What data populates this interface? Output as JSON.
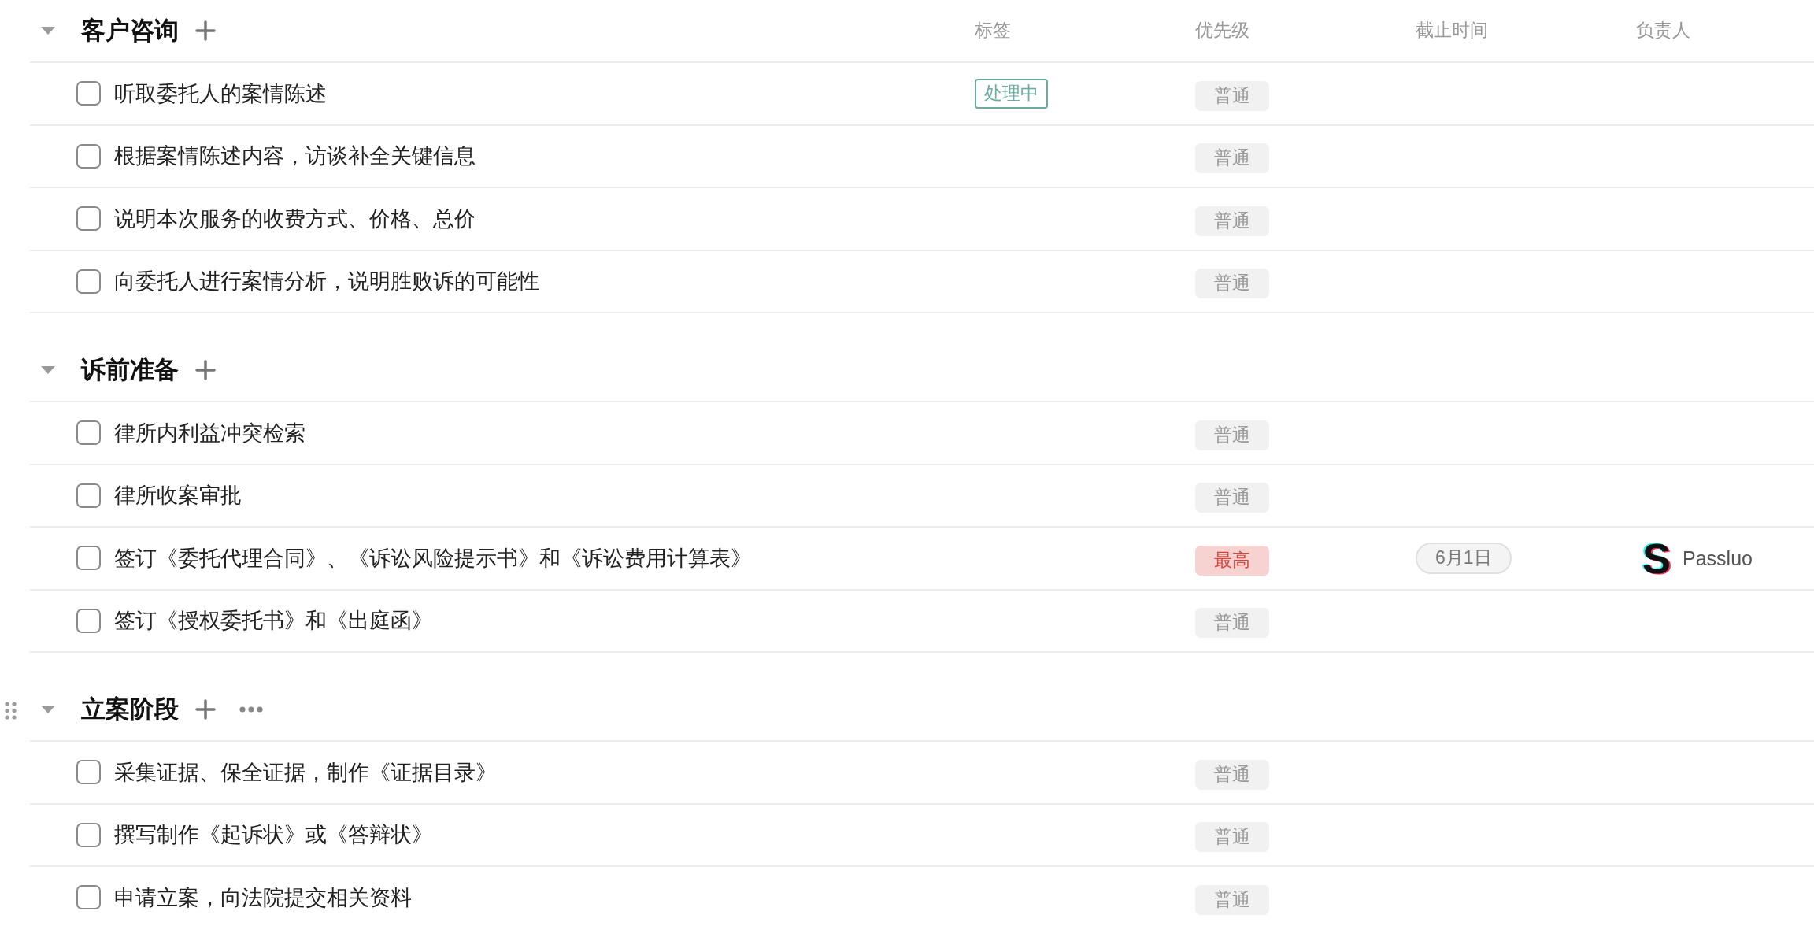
{
  "columns": [
    "标签",
    "优先级",
    "截止时间",
    "负责人"
  ],
  "sections": [
    {
      "title": "客户咨询",
      "expanded": true,
      "hovered": false,
      "tasks": [
        {
          "title": "听取委托人的案情陈述",
          "checked": false,
          "tag": {
            "label": "处理中",
            "color": "#6aada0"
          },
          "priority": {
            "label": "普通",
            "kind": "normal"
          }
        },
        {
          "title": "根据案情陈述内容，访谈补全关键信息",
          "checked": false,
          "priority": {
            "label": "普通",
            "kind": "normal"
          }
        },
        {
          "title": "说明本次服务的收费方式、价格、总价",
          "checked": false,
          "priority": {
            "label": "普通",
            "kind": "normal"
          }
        },
        {
          "title": "向委托人进行案情分析，说明胜败诉的可能性",
          "checked": false,
          "priority": {
            "label": "普通",
            "kind": "normal"
          }
        }
      ]
    },
    {
      "title": "诉前准备",
      "expanded": true,
      "hovered": false,
      "tasks": [
        {
          "title": "律所内利益冲突检索",
          "checked": false,
          "priority": {
            "label": "普通",
            "kind": "normal"
          }
        },
        {
          "title": "律所收案审批",
          "checked": false,
          "priority": {
            "label": "普通",
            "kind": "normal"
          }
        },
        {
          "title": "签订《委托代理合同》、《诉讼风险提示书》和《诉讼费用计算表》",
          "checked": false,
          "priority": {
            "label": "最高",
            "kind": "highest"
          },
          "due": "6月1日",
          "assignee": {
            "avatar": "S",
            "name": "Passluo"
          }
        },
        {
          "title": "签订《授权委托书》和《出庭函》",
          "checked": false,
          "priority": {
            "label": "普通",
            "kind": "normal"
          }
        }
      ]
    },
    {
      "title": "立案阶段",
      "expanded": true,
      "hovered": true,
      "tasks": [
        {
          "title": "采集证据、保全证据，制作《证据目录》",
          "checked": false,
          "priority": {
            "label": "普通",
            "kind": "normal"
          }
        },
        {
          "title": "撰写制作《起诉状》或《答辩状》",
          "checked": false,
          "priority": {
            "label": "普通",
            "kind": "normal"
          }
        },
        {
          "title": "申请立案，向法院提交相关资料",
          "checked": false,
          "priority": {
            "label": "普通",
            "kind": "normal"
          }
        }
      ]
    }
  ]
}
